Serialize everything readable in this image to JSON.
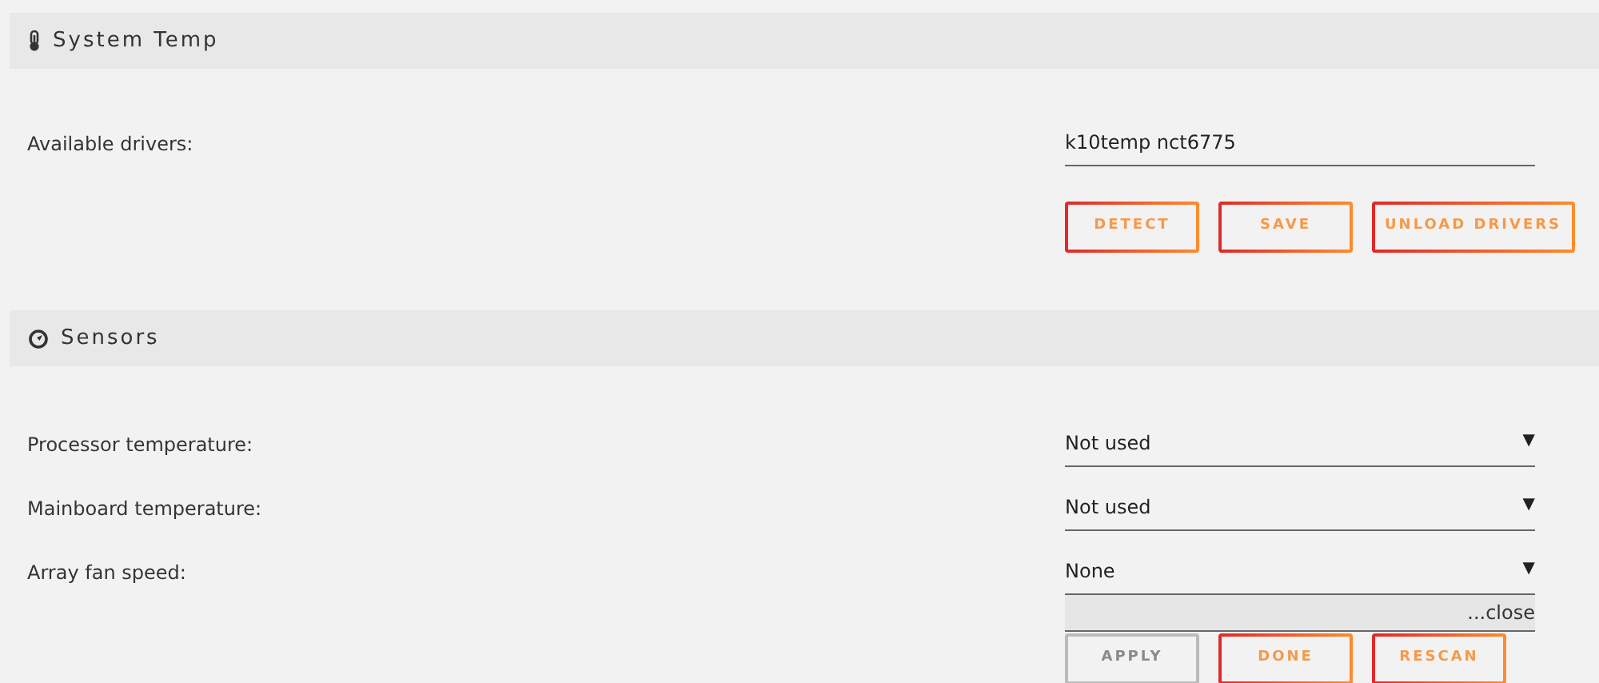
{
  "sections": [
    {
      "title": "System Temp",
      "rows": [
        {
          "label": "Available drivers:",
          "kind": "text",
          "value": "k10temp nct6775"
        }
      ],
      "buttons": [
        {
          "label": "DETECT",
          "disabled": false
        },
        {
          "label": "SAVE",
          "disabled": false
        },
        {
          "label": "UNLOAD DRIVERS",
          "disabled": false
        }
      ]
    },
    {
      "title": "Sensors",
      "rows": [
        {
          "label": "Processor temperature:",
          "kind": "select",
          "value": "Not used",
          "caret": "▼"
        },
        {
          "label": "Mainboard temperature:",
          "kind": "select",
          "value": "Not used",
          "caret": "▼"
        },
        {
          "label": "Array fan speed:",
          "kind": "select",
          "value": "None",
          "caret": "▼",
          "note": "...close"
        }
      ],
      "buttons": [
        {
          "label": "APPLY",
          "disabled": true
        },
        {
          "label": "DONE",
          "disabled": false
        },
        {
          "label": "RESCAN",
          "disabled": false
        }
      ]
    }
  ]
}
